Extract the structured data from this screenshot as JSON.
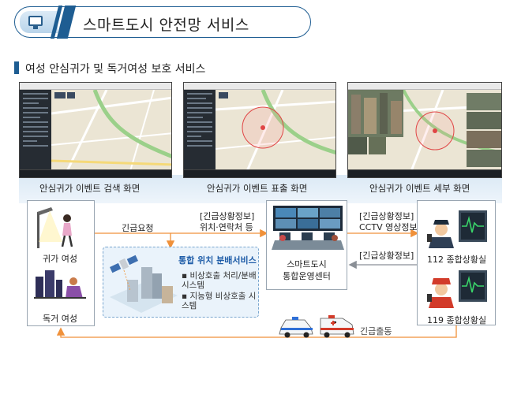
{
  "header": {
    "title": "스마트도시 안전망 서비스"
  },
  "section": {
    "title": "여성 안심귀가 및 독거여성 보호 서비스"
  },
  "screens": [
    {
      "caption": "안심귀가 이벤트 검색 화면"
    },
    {
      "caption": "안심귀가 이벤트 표출 화면"
    },
    {
      "caption": "안심귀가 이벤트 세부 화면"
    }
  ],
  "left_box": {
    "top_label": "귀가 여성",
    "bottom_label": "독거 여성"
  },
  "request_label": "긴급요청",
  "emergency_info_1": {
    "title": "[긴급상황정보]",
    "detail": "위치·연락처 등"
  },
  "service_box": {
    "title": "통합 위치 분배서비스",
    "items": [
      "비상호출 처리/분배 시스템",
      "지능형 비상호출 시스템"
    ]
  },
  "center_box": {
    "line1": "스마트도시",
    "line2": "통합운영센터"
  },
  "emergency_info_2": {
    "title": "[긴급상황정보]",
    "detail": "CCTV 영상정보"
  },
  "emergency_info_3": {
    "title": "[긴급상황정보]"
  },
  "right_box": {
    "top_label": "112 종합상황실",
    "bottom_label": "119 종합상황실"
  },
  "dispatch_label": "긴급출동",
  "colors": {
    "accent_blue": "#1e5d92",
    "flow_orange": "#f0913a",
    "info_grey": "#8a8f96"
  }
}
